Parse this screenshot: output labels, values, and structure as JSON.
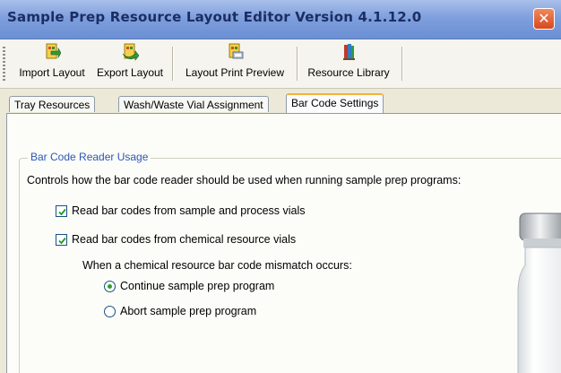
{
  "window": {
    "title": "Sample Prep Resource Layout Editor Version 4.1.12.0",
    "close_glyph": "✕"
  },
  "toolbar": {
    "buttons": [
      {
        "label": "Import Layout",
        "icon": "import-layout-icon"
      },
      {
        "label": "Export Layout",
        "icon": "export-layout-icon"
      },
      {
        "label": "Layout Print Preview",
        "icon": "print-preview-icon"
      },
      {
        "label": "Resource Library",
        "icon": "resource-library-icon"
      }
    ]
  },
  "tabs": [
    {
      "label": "Tray Resources",
      "active": false
    },
    {
      "label": "Wash/Waste Vial Assignment",
      "active": false
    },
    {
      "label": "Bar Code Settings",
      "active": true
    }
  ],
  "bar_code": {
    "group_title": "Bar Code Reader Usage",
    "description": "Controls how the bar code reader should be used when running sample prep programs:",
    "checkboxes": [
      {
        "label": "Read bar codes from sample and process vials",
        "checked": true
      },
      {
        "label": "Read bar codes from chemical resource vials",
        "checked": true
      }
    ],
    "mismatch_note": "When a chemical resource bar code mismatch occurs:",
    "radios": [
      {
        "label": "Continue sample prep program",
        "selected": true
      },
      {
        "label": "Abort sample prep program",
        "selected": false
      }
    ]
  },
  "colors": {
    "titlebar": "#7f9fdd",
    "group_title": "#2a58b5",
    "active_tab_accent": "#f2b33a",
    "radio_selected": "#2ea12a"
  }
}
